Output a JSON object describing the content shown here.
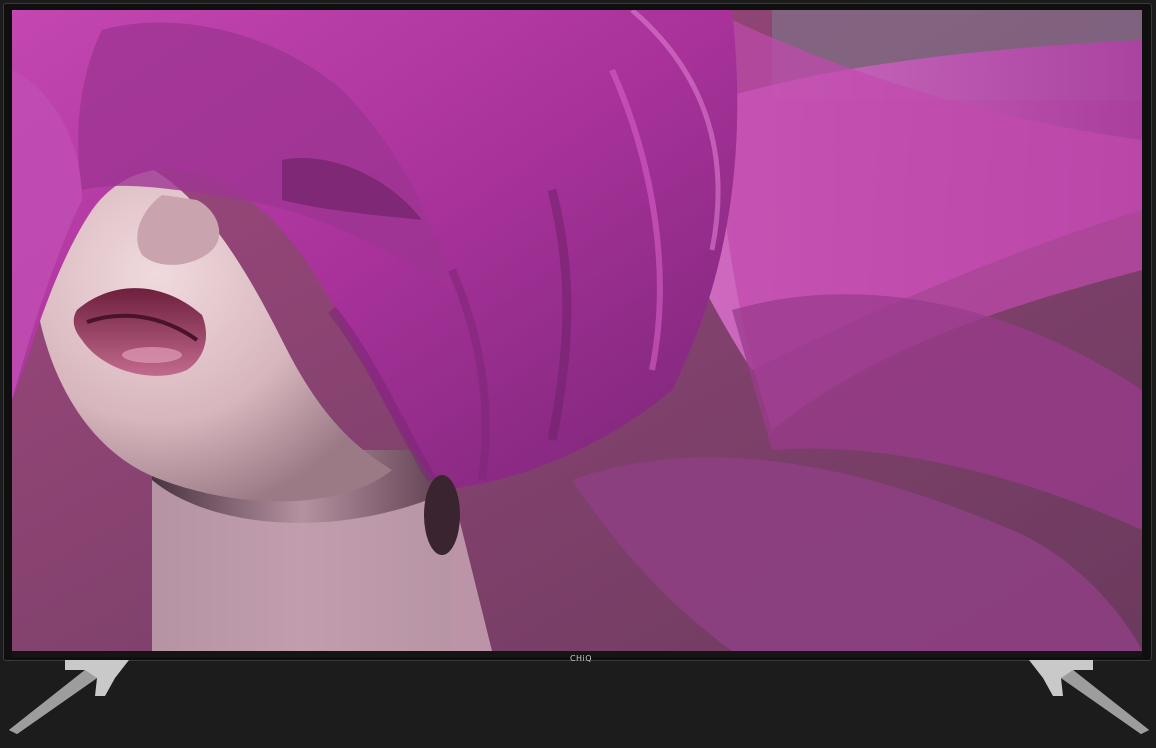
{
  "product": {
    "brand_logo_text": "CHiQ"
  },
  "colors": {
    "background": "#1c1c1c",
    "bezel": "#0f0f0f",
    "fabric_magenta": "#b4369e",
    "backdrop_purple": "#7b3f6e",
    "skin": "#d9bcc0",
    "lips": "#8e2a4e",
    "stand_silver": "#c9c9c9"
  },
  "icons": {
    "screen_image": "woman-with-magenta-veil-image",
    "left_stand": "tv-stand-foot-icon",
    "right_stand": "tv-stand-foot-icon"
  }
}
